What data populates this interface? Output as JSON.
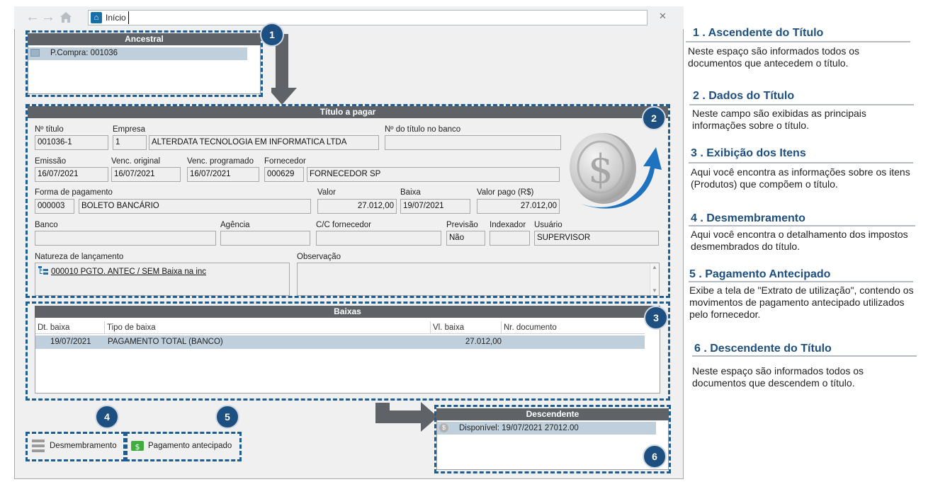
{
  "window": {
    "address": "Início"
  },
  "ancestral": {
    "header": "Ancestral",
    "item": "P.Compra: 001036"
  },
  "titulo": {
    "header": "Título a pagar",
    "labels": {
      "n_titulo": "Nº título",
      "empresa": "Empresa",
      "n_banco": "Nº do título no banco",
      "emissao": "Emissão",
      "venc_original": "Venc. original",
      "venc_programado": "Venc. programado",
      "fornecedor": "Fornecedor",
      "forma_pagamento": "Forma de pagamento",
      "valor": "Valor",
      "baixa": "Baixa",
      "valor_pago": "Valor pago (R$)",
      "banco": "Banco",
      "agencia": "Agência",
      "cc_fornecedor": "C/C fornecedor",
      "previsao": "Previsão",
      "indexador": "Indexador",
      "usuario": "Usuário",
      "natureza": "Natureza de lançamento",
      "observacao": "Observação"
    },
    "values": {
      "n_titulo": "001036-1",
      "empresa_code": "1",
      "empresa_name": "ALTERDATA TECNOLOGIA EM INFORMATICA LTDA",
      "n_banco": "",
      "emissao": "16/07/2021",
      "venc_original": "16/07/2021",
      "venc_programado": "16/07/2021",
      "fornecedor_code": "000629",
      "fornecedor_name": "FORNECEDOR SP",
      "forma_code": "000003",
      "forma_name": "BOLETO BANCÁRIO",
      "valor": "27.012,00",
      "baixa": "19/07/2021",
      "valor_pago": "27.012,00",
      "banco": "",
      "agencia": "",
      "cc_fornecedor": "",
      "previsao": "Não",
      "indexador": "",
      "usuario": "SUPERVISOR",
      "natureza": "000010 PGTO. ANTEC / SEM Baixa na inc",
      "observacao": ""
    }
  },
  "baixas": {
    "header": "Baixas",
    "columns": [
      "Dt. baixa",
      "Tipo de baixa",
      "Vl. baixa",
      "Nr. documento"
    ],
    "rows": [
      {
        "dt": "19/07/2021",
        "tipo": "PAGAMENTO TOTAL (BANCO)",
        "vl": "27.012,00",
        "nr": ""
      }
    ]
  },
  "buttons": {
    "desmembramento": "Desmembramento",
    "pagamento_antecipado": "Pagamento antecipado"
  },
  "descendente": {
    "header": "Descendente",
    "item": "Disponível: 19/07/2021  27012.00"
  },
  "badges": [
    "1",
    "2",
    "3",
    "4",
    "5",
    "6"
  ],
  "legend": [
    {
      "title": "1 . Ascendente do Título",
      "text": "Neste espaço são informados todos os documentos que antecedem o título."
    },
    {
      "title": "2 . Dados do Título",
      "text": "Neste campo são exibidas as principais informações sobre o título."
    },
    {
      "title": "3 . Exibição dos Itens",
      "text": "Aqui você encontra as informações sobre os itens (Produtos) que compõem o título."
    },
    {
      "title": "4 . Desmembramento",
      "text": "Aqui você encontra o detalhamento dos impostos desmembrados do título."
    },
    {
      "title": "5 . Pagamento Antecipado",
      "text": "Exibe a tela de \"Extrato de utilização\", contendo os movimentos de pagamento antecipado utilizados pelo fornecedor."
    },
    {
      "title": "6 . Descendente do Título",
      "text": "Neste espaço são informados todos os documentos que descendem o título."
    }
  ],
  "colors": {
    "header_bar": "#5f6368",
    "badge": "#1d4f80",
    "selected_row": "#bfd0dc",
    "legend_title": "#1d4f80"
  },
  "icons": [
    "back-arrow-icon",
    "forward-arrow-icon",
    "home-icon",
    "close-icon",
    "document-icon",
    "tree-icon",
    "list-icon",
    "money-icon",
    "dollar-coin-icon"
  ]
}
